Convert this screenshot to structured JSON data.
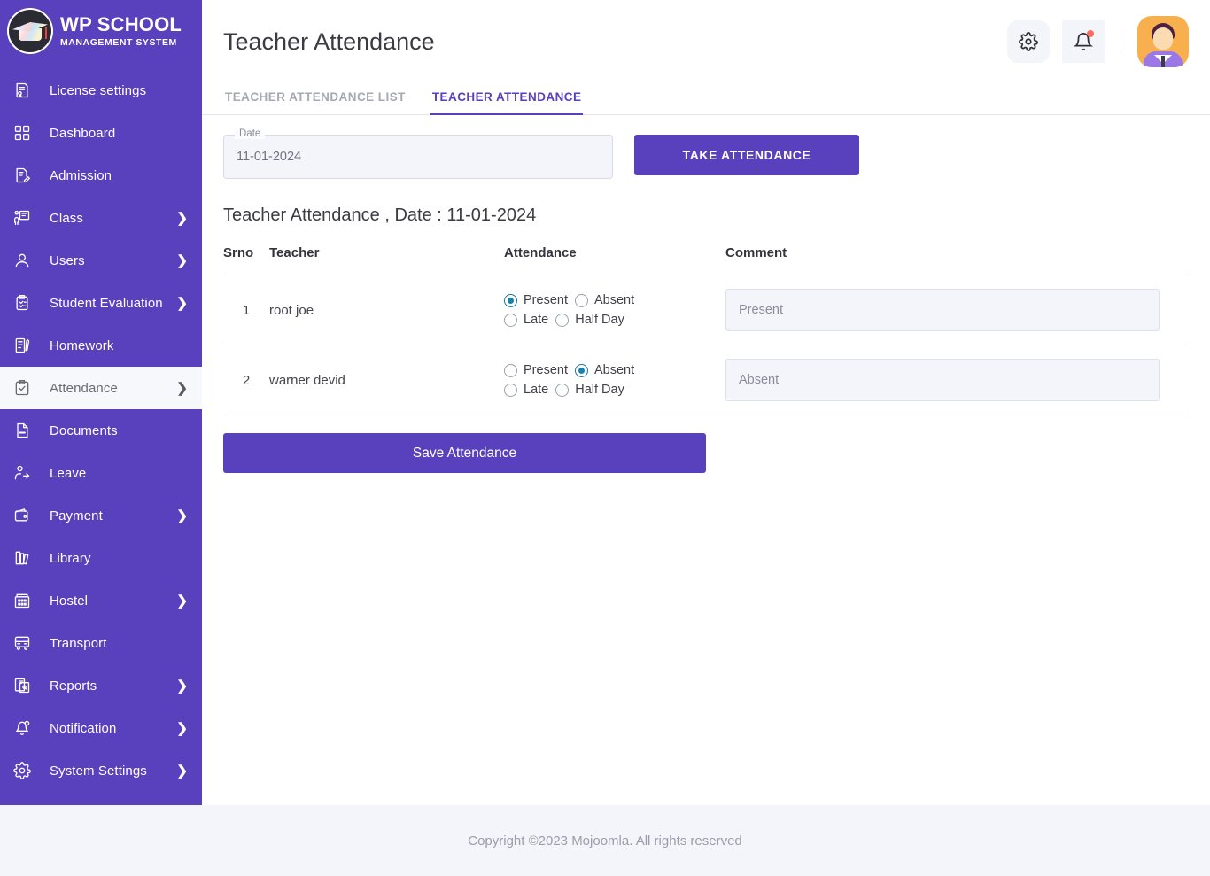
{
  "brand": {
    "title": "WP SCHOOL",
    "subtitle": "MANAGEMENT SYSTEM",
    "logo_icon": "graduation-cap-logo"
  },
  "sidebar": {
    "background_color": "#5940bd",
    "active_background_color": "#f7f8fc",
    "items": [
      {
        "label": "License settings",
        "icon": "certificate-icon",
        "has_arrow": false,
        "active": false
      },
      {
        "label": "Dashboard",
        "icon": "grid-squares-icon",
        "has_arrow": false,
        "active": false
      },
      {
        "label": "Admission",
        "icon": "document-pencil-icon",
        "has_arrow": false,
        "active": false
      },
      {
        "label": "Class",
        "icon": "teacher-board-icon",
        "has_arrow": true,
        "active": false
      },
      {
        "label": "Users",
        "icon": "user-icon",
        "has_arrow": true,
        "active": false
      },
      {
        "label": "Student Evaluation",
        "icon": "clipboard-check-icon",
        "has_arrow": true,
        "active": false
      },
      {
        "label": "Homework",
        "icon": "notebook-pen-icon",
        "has_arrow": false,
        "active": false
      },
      {
        "label": "Attendance",
        "icon": "clipboard-tick-icon",
        "has_arrow": true,
        "active": true
      },
      {
        "label": "Documents",
        "icon": "doc-file-icon",
        "has_arrow": false,
        "active": false
      },
      {
        "label": "Leave",
        "icon": "user-exit-icon",
        "has_arrow": false,
        "active": false
      },
      {
        "label": "Payment",
        "icon": "wallet-icon",
        "has_arrow": true,
        "active": false
      },
      {
        "label": "Library",
        "icon": "books-icon",
        "has_arrow": false,
        "active": false
      },
      {
        "label": "Hostel",
        "icon": "hostel-building-icon",
        "has_arrow": true,
        "active": false
      },
      {
        "label": "Transport",
        "icon": "bus-icon",
        "has_arrow": false,
        "active": false
      },
      {
        "label": "Reports",
        "icon": "report-pages-icon",
        "has_arrow": true,
        "active": false
      },
      {
        "label": "Notification",
        "icon": "bell-alert-icon",
        "has_arrow": true,
        "active": false
      },
      {
        "label": "System Settings",
        "icon": "gear-icon",
        "has_arrow": true,
        "active": false
      }
    ],
    "arrow_glyph": "❯"
  },
  "header": {
    "title": "Teacher Attendance",
    "settings_icon": "gear-icon",
    "notification_icon": "bell-icon",
    "notification_badge": true,
    "avatar_icon": "user-avatar"
  },
  "tabs": [
    {
      "label": "TEACHER ATTENDANCE LIST",
      "active": false
    },
    {
      "label": "TEACHER ATTENDANCE",
      "active": true
    }
  ],
  "accent_color": "#5941bd",
  "form": {
    "date_label": "Date",
    "date_value": "11-01-2024",
    "take_attendance_label": "TAKE ATTENDANCE"
  },
  "subheading": "Teacher Attendance , Date : 11-01-2024",
  "table": {
    "columns": [
      "Srno",
      "Teacher",
      "Attendance",
      "Comment"
    ],
    "attendance_options": [
      "Present",
      "Absent",
      "Late",
      "Half Day"
    ],
    "rows": [
      {
        "srno": "1",
        "teacher": "root joe",
        "selected": "Present",
        "comment_placeholder": "Present",
        "comment_value": ""
      },
      {
        "srno": "2",
        "teacher": "warner devid",
        "selected": "Absent",
        "comment_placeholder": "Absent",
        "comment_value": ""
      }
    ]
  },
  "save_button_label": "Save Attendance",
  "footer": {
    "text": "Copyright ©2023 Mojoomla. All rights reserved"
  }
}
